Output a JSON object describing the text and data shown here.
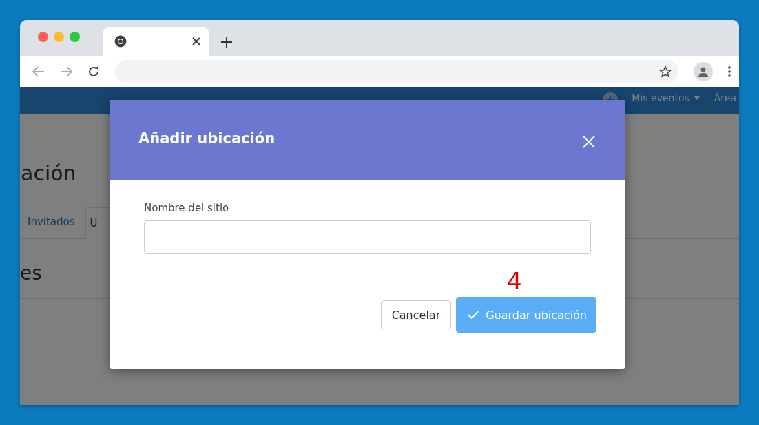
{
  "browser": {
    "tabs": [
      {
        "selected": true
      }
    ]
  },
  "page": {
    "nav": {
      "items": [
        {
          "kind": "icon"
        },
        {
          "kind": "dropdown",
          "label": "Mis eventos"
        },
        {
          "kind": "link",
          "label": "Área"
        }
      ]
    },
    "heading": "ación",
    "tabs": [
      {
        "label": "Invitados",
        "selected": false
      },
      {
        "label": "U",
        "selected": true
      }
    ],
    "section_heading": "es"
  },
  "dialog": {
    "title": "Añadir ubicación",
    "field": {
      "label": "Nombre del sitio"
    },
    "buttons": [
      {
        "kind": "secondary",
        "label": "Cancelar"
      },
      {
        "kind": "primary",
        "label": "Guardar ubicación"
      }
    ]
  },
  "annotation": {
    "text": "4",
    "color": "#e00000"
  }
}
